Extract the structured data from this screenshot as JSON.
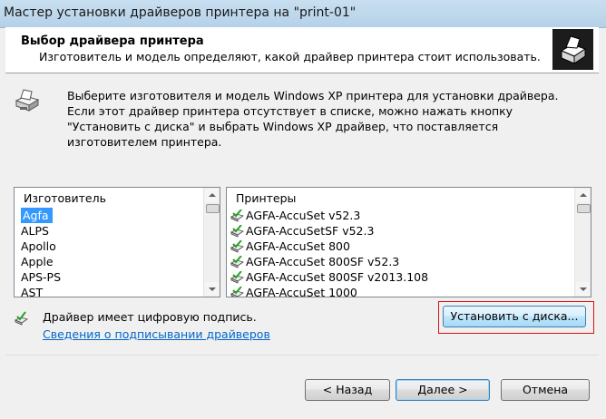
{
  "window": {
    "title": "Мастер установки драйверов принтера на \"print-01\""
  },
  "header": {
    "title": "Выбор драйвера принтера",
    "subtitle": "Изготовитель и модель определяют, какой драйвер принтера стоит использовать.",
    "icon": "printer-icon"
  },
  "description": {
    "icon": "printer-icon",
    "text": "Выберите изготовителя и модель Windows XP принтера для установки драйвера. Если этот драйвер принтера отсутствует в списке, можно нажать кнопку \"Установить с диска\" и выбрать Windows XP драйвер, что поставляется изготовителем принтера."
  },
  "manufacturers": {
    "header": "Изготовитель",
    "items": [
      "Agfa",
      "ALPS",
      "Apollo",
      "Apple",
      "APS-PS",
      "AST"
    ],
    "selected": "Agfa"
  },
  "printers": {
    "header": "Принтеры",
    "items": [
      "AGFA-AccuSet v52.3",
      "AGFA-AccuSetSF v52.3",
      "AGFA-AccuSet 800",
      "AGFA-AccuSet 800SF v52.3",
      "AGFA-AccuSet 800SF v2013.108",
      "AGFA-AccuSet 1000"
    ],
    "item_icon": "signed-driver-icon"
  },
  "signature": {
    "icon": "signed-driver-icon",
    "text": "Драйвер имеет цифровую подпись.",
    "link": "Сведения о подписывании драйверов"
  },
  "buttons": {
    "have_disk": "Установить с диска...",
    "back": "< Назад",
    "next": "Далее >",
    "cancel": "Отмена"
  },
  "colors": {
    "selection": "#3399ff",
    "link": "#0066cc",
    "highlight_box": "#e01010"
  }
}
